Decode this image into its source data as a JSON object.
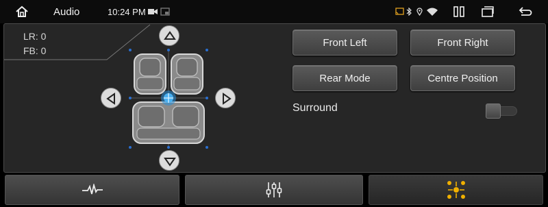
{
  "statusbar": {
    "app_title": "Audio",
    "time": "10:24 PM",
    "icons": [
      "home-icon",
      "camera-icon",
      "screen-icon",
      "cast-icon",
      "bluetooth-icon",
      "location-icon",
      "wifi-icon",
      "split-screen-icon",
      "recents-icon",
      "back-icon"
    ]
  },
  "balance": {
    "lr_label": "LR: 0",
    "fb_label": "FB: 0"
  },
  "buttons": {
    "front_left": "Front Left",
    "front_right": "Front Right",
    "rear_mode": "Rear Mode",
    "centre_position": "Centre Position"
  },
  "surround": {
    "label": "Surround",
    "enabled": false
  },
  "tabs": [
    {
      "icon": "waveform-icon",
      "active": false
    },
    {
      "icon": "equalizer-sliders-icon",
      "active": false
    },
    {
      "icon": "speaker-position-icon",
      "active": true
    }
  ],
  "colors": {
    "accent_active": "#f0b000",
    "marker_blue": "#2a8fd8"
  }
}
